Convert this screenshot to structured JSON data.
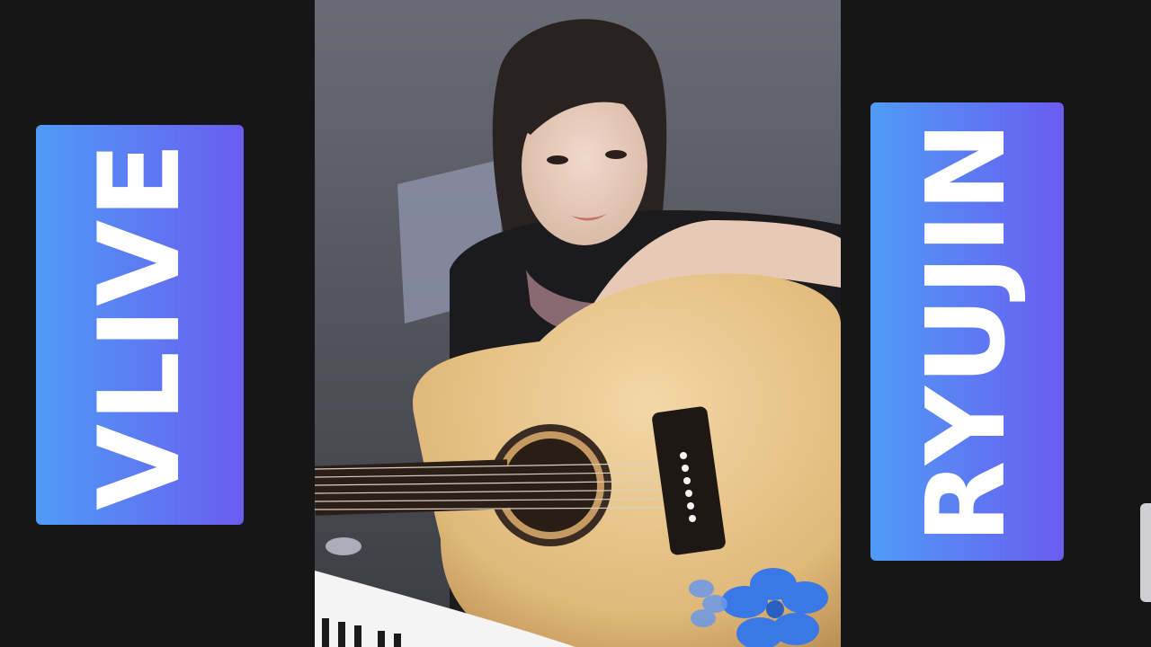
{
  "overlay": {
    "left_label": "VLIVE",
    "right_label": "RYUJIN"
  },
  "colors": {
    "tag_gradient_start": "#4f9bf6",
    "tag_gradient_end": "#6a5cf0",
    "background": "#121212"
  },
  "photo": {
    "icons": [
      "flower-sticker-icon"
    ]
  }
}
